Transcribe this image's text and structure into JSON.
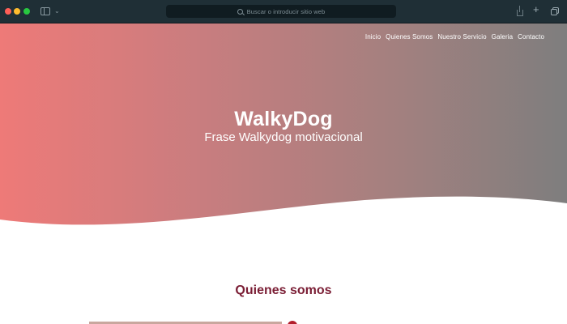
{
  "browser": {
    "address_placeholder": "Buscar o introducir sitio web",
    "icons": [
      "close-dot",
      "minimize-dot",
      "maximize-dot",
      "sidebar-icon",
      "chevron-down-icon",
      "search-icon",
      "share-icon",
      "plus-icon",
      "tabs-icon"
    ],
    "colors": {
      "chrome": "#1f2f36",
      "address_bg": "#101c21"
    }
  },
  "nav": {
    "items": [
      {
        "label": "Inicio"
      },
      {
        "label": "Quienes Somos"
      },
      {
        "label": "Nuestro Servicio"
      },
      {
        "label": "Galeria"
      },
      {
        "label": "Contacto"
      }
    ]
  },
  "hero": {
    "title": "WalkyDog",
    "subtitle": "Frase Walkydog motivacional",
    "colors": {
      "gradient_start": "#ee7a78",
      "gradient_end": "#7e7e7e"
    }
  },
  "section": {
    "title": "Quienes somos",
    "colors": {
      "title": "#7a1d34"
    }
  }
}
